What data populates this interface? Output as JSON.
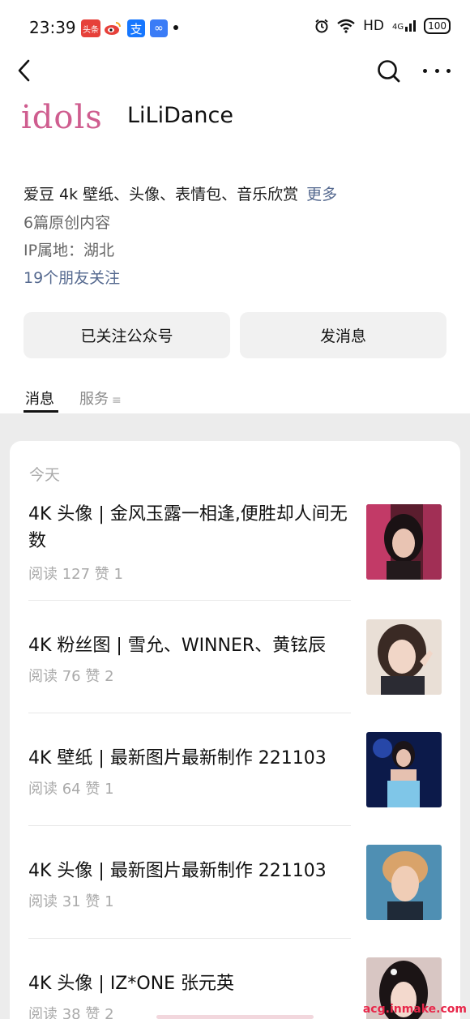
{
  "status_bar": {
    "time": "23:39",
    "apps": [
      "toutiao-icon",
      "weibo-icon",
      "alipay-icon",
      "infinity-icon"
    ],
    "network": "HD",
    "signal": "4G",
    "battery": "100"
  },
  "nav": {
    "back_icon": "chevron-left-icon",
    "search_icon": "search-icon",
    "more_icon": "more-dots-icon"
  },
  "profile": {
    "logo_text": "idols",
    "name": "LiLiDance",
    "description": "爱豆 4k 壁纸、头像、表情包、音乐欣赏",
    "description_more": "更多",
    "original_count": "6篇原创内容",
    "ip_location": "IP属地：湖北",
    "friends_following": "19个朋友关注"
  },
  "actions": {
    "followed_label": "已关注公众号",
    "message_label": "发消息"
  },
  "tabs": {
    "messages": "消息",
    "services": "服务",
    "services_icon": "≡"
  },
  "feed": {
    "section_label": "今天",
    "articles": [
      {
        "title": "4K 头像 | 金风玉露一相逢,便胜却人间无数",
        "stats": "阅读 127   赞 1"
      },
      {
        "title": "4K 粉丝图 | 雪允、WINNER、黄铉辰",
        "stats": "阅读 76   赞 2"
      },
      {
        "title": "4K 壁纸 | 最新图片最新制作 221103",
        "stats": "阅读 64   赞 1"
      },
      {
        "title": "4K 头像 | 最新图片最新制作 221103",
        "stats": "阅读 31   赞 1"
      },
      {
        "title": "4K 头像 | IZ*ONE 张元英",
        "stats": "阅读 38   赞 2"
      }
    ]
  },
  "watermark": "acg.inmake.com"
}
